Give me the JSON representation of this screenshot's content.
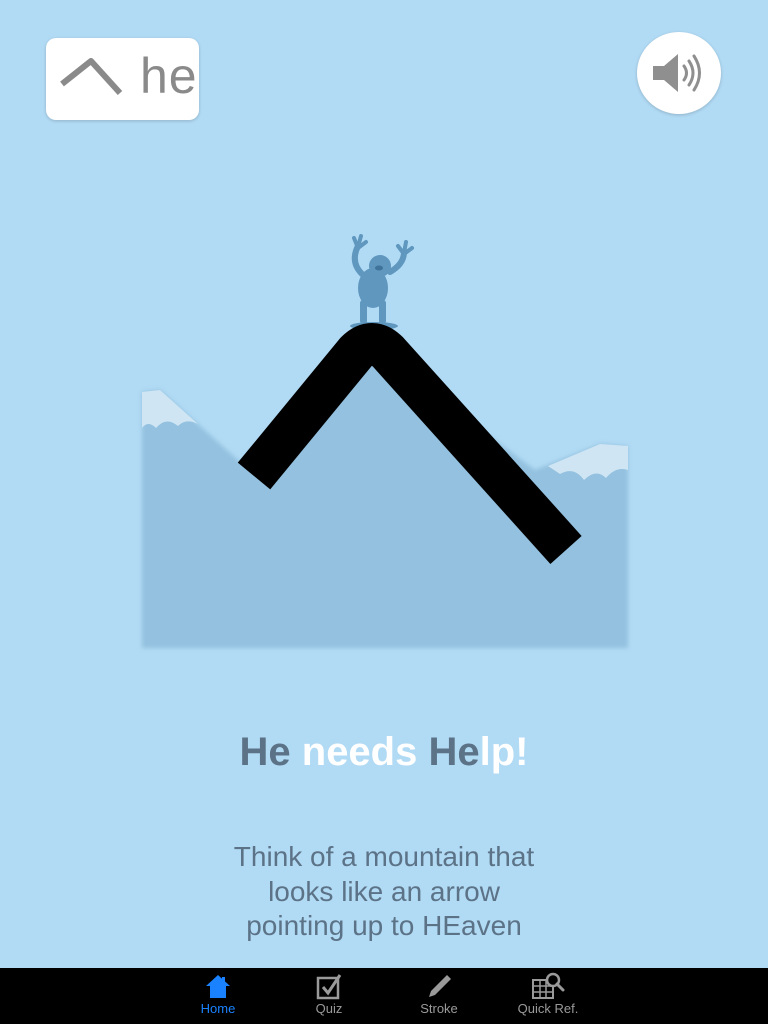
{
  "card": {
    "label": "he",
    "icon": "chevron-up-icon"
  },
  "sound_button": {
    "icon": "speaker-icon"
  },
  "phrase": {
    "parts": [
      {
        "text": "He",
        "style": "dark"
      },
      {
        "text": " needs ",
        "style": "light"
      },
      {
        "text": "He",
        "style": "dark"
      },
      {
        "text": "lp!",
        "style": "light"
      }
    ]
  },
  "hint": {
    "line1": "Think of a mountain that",
    "line2": "looks like an arrow",
    "line3": "pointing up to HEaven"
  },
  "tabs": [
    {
      "label": "Home",
      "icon": "house-icon",
      "active": true
    },
    {
      "label": "Quiz",
      "icon": "checkbox-icon",
      "active": false
    },
    {
      "label": "Stroke",
      "icon": "pencil-icon",
      "active": false
    },
    {
      "label": "Quick Ref.",
      "icon": "grid-magnifier-icon",
      "active": false
    }
  ],
  "colors": {
    "background": "#b1daf4",
    "text_dark": "#5c7387",
    "text_light": "#ffffff",
    "mountain": "#93c1df",
    "figure": "#5f97bf",
    "tab_active": "#1a82ff",
    "tab_inactive": "#9a9a9a"
  }
}
